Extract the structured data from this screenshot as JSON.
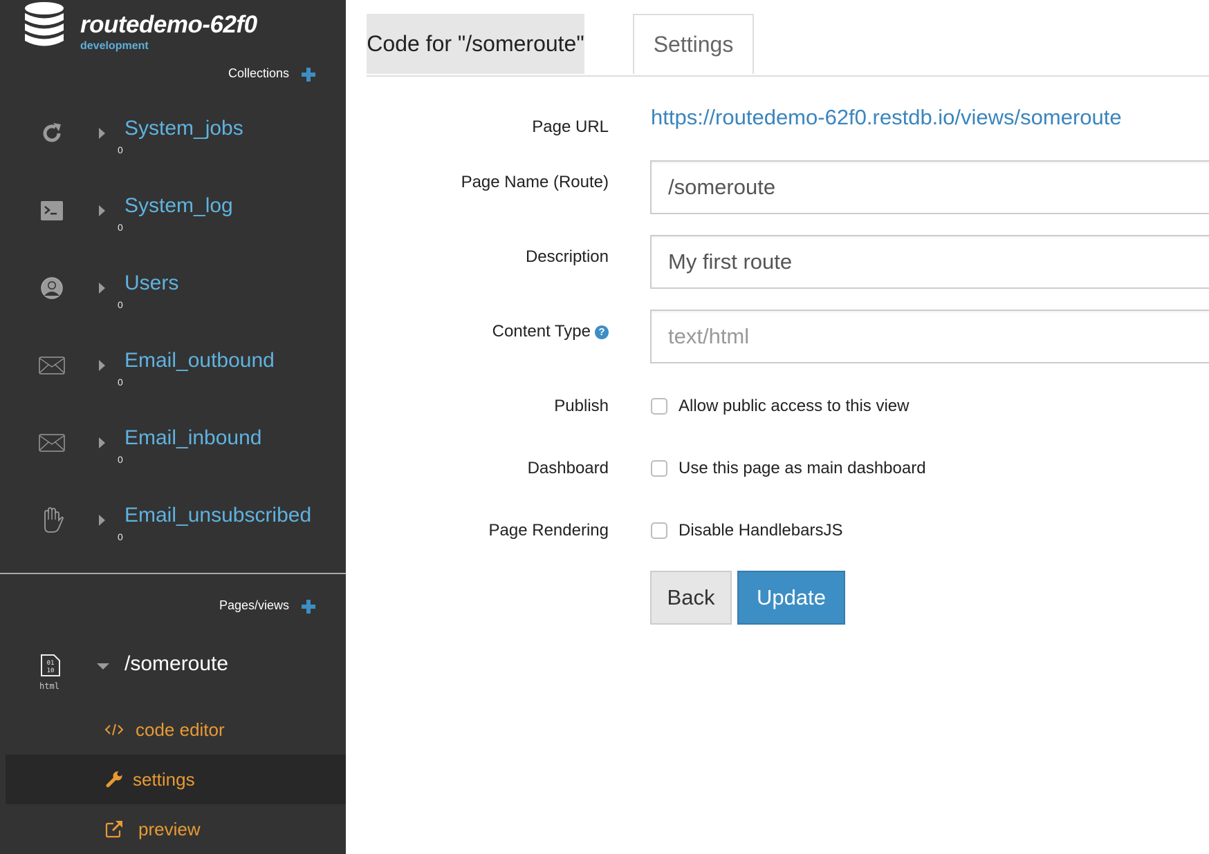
{
  "app": {
    "title": "routedemo-62f0",
    "environment": "development"
  },
  "sidebar": {
    "collections_heading": "Collections",
    "collections": [
      {
        "name": "System_jobs",
        "count": "0",
        "icon": "refresh-icon"
      },
      {
        "name": "System_log",
        "count": "0",
        "icon": "terminal-icon"
      },
      {
        "name": "Users",
        "count": "0",
        "icon": "user-icon"
      },
      {
        "name": "Email_outbound",
        "count": "0",
        "icon": "envelope-icon"
      },
      {
        "name": "Email_inbound",
        "count": "0",
        "icon": "envelope-icon"
      },
      {
        "name": "Email_unsubscribed",
        "count": "0",
        "icon": "hand-icon"
      }
    ],
    "pages_heading": "Pages/views",
    "page": {
      "name": "/someroute",
      "type_label": "html",
      "file_icon_text": "01 10"
    },
    "page_subitems": [
      {
        "label": "code editor",
        "icon": "code-icon"
      },
      {
        "label": "settings",
        "icon": "wrench-icon",
        "active": true
      },
      {
        "label": "preview",
        "icon": "external-link-icon"
      }
    ]
  },
  "tabs": [
    {
      "label": "Code for \"/someroute\""
    },
    {
      "label": "Settings",
      "active": true
    }
  ],
  "form": {
    "page_url_label": "Page URL",
    "page_url": "https://routedemo-62f0.restdb.io/views/someroute",
    "page_name_label": "Page Name (Route)",
    "page_name_value": "/someroute",
    "description_label": "Description",
    "description_value": "My first route",
    "content_type_label": "Content Type",
    "content_type_placeholder": "text/html",
    "help_glyph": "?",
    "publish_label": "Publish",
    "publish_text": "Allow public access to this view",
    "publish_checked": false,
    "dashboard_label": "Dashboard",
    "dashboard_text": "Use this page as main dashboard",
    "dashboard_checked": false,
    "rendering_label": "Page Rendering",
    "rendering_text": "Disable HandlebarsJS",
    "rendering_checked": false,
    "back_label": "Back",
    "update_label": "Update"
  },
  "colors": {
    "sidebar_bg": "#333333",
    "link_blue": "#5fb3e0",
    "accent_orange": "#e89a34",
    "primary": "#3d8ec4"
  }
}
